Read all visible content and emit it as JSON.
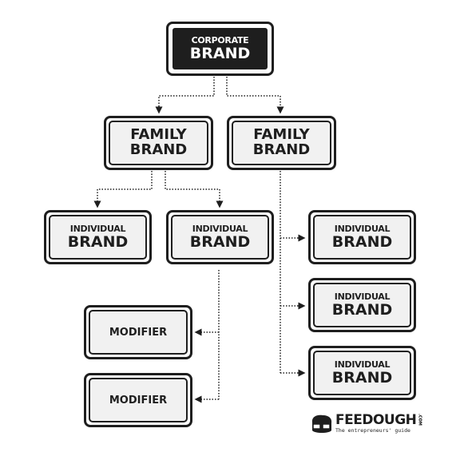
{
  "corporate": {
    "line1": "CORPORATE",
    "line2": "BRAND"
  },
  "family": [
    {
      "line1": "FAMILY",
      "line2": "BRAND"
    },
    {
      "line1": "FAMILY",
      "line2": "BRAND"
    }
  ],
  "individual": [
    {
      "line1": "INDIVIDUAL",
      "line2": "BRAND"
    },
    {
      "line1": "INDIVIDUAL",
      "line2": "BRAND"
    },
    {
      "line1": "INDIVIDUAL",
      "line2": "BRAND"
    },
    {
      "line1": "INDIVIDUAL",
      "line2": "BRAND"
    },
    {
      "line1": "INDIVIDUAL",
      "line2": "BRAND"
    }
  ],
  "modifier": [
    {
      "label": "MODIFIER"
    },
    {
      "label": "MODIFIER"
    }
  ],
  "logo": {
    "name": "FEEDOUGH",
    "suffix": ".COM",
    "tagline": "The entrepreneurs' guide"
  },
  "colors": {
    "ink": "#1e1e1e",
    "fill": "#f1f1f1"
  }
}
